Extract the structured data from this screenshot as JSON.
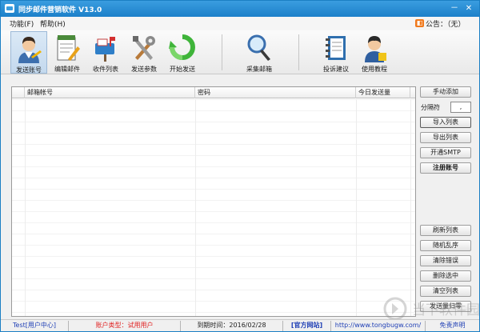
{
  "window": {
    "title": "同步邮件营销软件    V13.0",
    "minimize": "－",
    "close": "✕"
  },
  "menu": {
    "items": [
      "功能(F)",
      "帮助(H)"
    ],
    "notice": "公告：（无）"
  },
  "toolbar": {
    "tools": [
      {
        "label": "发送账号",
        "icon": "user-avatar-icon"
      },
      {
        "label": "编辑邮件",
        "icon": "notepad-pencil-icon"
      },
      {
        "label": "收件列表",
        "icon": "mailbox-icon"
      },
      {
        "label": "发送参数",
        "icon": "wrench-tools-icon"
      },
      {
        "label": "开始发送",
        "icon": "green-refresh-icon"
      },
      {
        "label": "采集邮箱",
        "icon": "magnifier-icon"
      },
      {
        "label": "投诉建议",
        "icon": "notebook-icon"
      },
      {
        "label": "使用教程",
        "icon": "tutor-person-icon"
      }
    ]
  },
  "grid": {
    "columns": [
      "",
      "邮箱帐号",
      "密码",
      "今日发送量"
    ],
    "rows": []
  },
  "side": {
    "manual_add": "手动添加",
    "separator_label": "分隔符",
    "separator_value": ",",
    "import_list": "导入列表",
    "export_list": "导出列表",
    "enable_smtp": "开通SMTP",
    "register_account": "注册账号",
    "refresh_list": "刷新列表",
    "random_order": "随机乱序",
    "clear_errors": "清除错误",
    "delete_selected": "删除选中",
    "clear_list": "清空列表",
    "send_zero": "发送量归零"
  },
  "watermark": {
    "text": "当下软件园"
  },
  "status": {
    "user": "Test[用户中心]",
    "account_type": "账户类型：试用用户",
    "expire": "到期时间：2016/02/28",
    "official": "[官方网站]",
    "url": "http://www.tongbugw.com/",
    "disclaimer": "免责声明"
  },
  "colors": {
    "title_bar": "#1c80c9",
    "status_link": "#1f3fb5",
    "status_warn": "#e02020"
  }
}
